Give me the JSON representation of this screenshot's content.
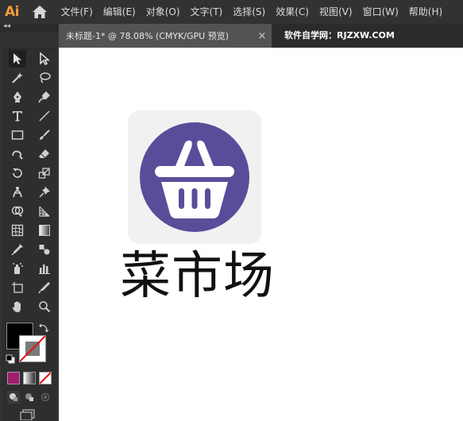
{
  "app": {
    "logo_text": "Ai",
    "colors": {
      "accent": "#f59b3a",
      "chrome": "#323232",
      "canvas": "#ffffff"
    }
  },
  "menubar": {
    "items": [
      "文件(F)",
      "编辑(E)",
      "对象(O)",
      "文字(T)",
      "选择(S)",
      "效果(C)",
      "视图(V)",
      "窗口(W)",
      "帮助(H)"
    ]
  },
  "tabs": {
    "document_title": "未标题-1* @ 78.08% (CMYK/GPU 预览)",
    "close_glyph": "×",
    "watermark": "软件自学网：RJZXW.COM"
  },
  "toolbar": {
    "collapse_glyph": "◂◂",
    "tools": [
      [
        "selection-tool",
        "direct-selection-tool"
      ],
      [
        "magic-wand-tool",
        "lasso-tool"
      ],
      [
        "pen-tool",
        "curvature-tool"
      ],
      [
        "type-tool",
        "line-segment-tool"
      ],
      [
        "rectangle-tool",
        "paintbrush-tool"
      ],
      [
        "shaper-tool",
        "eraser-tool"
      ],
      [
        "rotate-tool",
        "scale-tool"
      ],
      [
        "puppet-warp-tool",
        "pin-tool"
      ],
      [
        "shape-builder-tool",
        "perspective-grid-tool"
      ],
      [
        "mesh-tool",
        "gradient-tool"
      ],
      [
        "eyedropper-tool",
        "blend-tool"
      ],
      [
        "symbol-sprayer-tool",
        "column-graph-tool"
      ],
      [
        "artboard-tool",
        "slice-tool"
      ],
      [
        "hand-tool",
        "zoom-tool"
      ]
    ],
    "fill_color": "#000000",
    "stroke_color": "none"
  },
  "artwork": {
    "icon_name": "shopping-basket-icon",
    "circle_color": "#5b4c9a",
    "basket_color": "#ffffff",
    "background_color": "#f1f1f1",
    "logo_text": "菜市场"
  }
}
